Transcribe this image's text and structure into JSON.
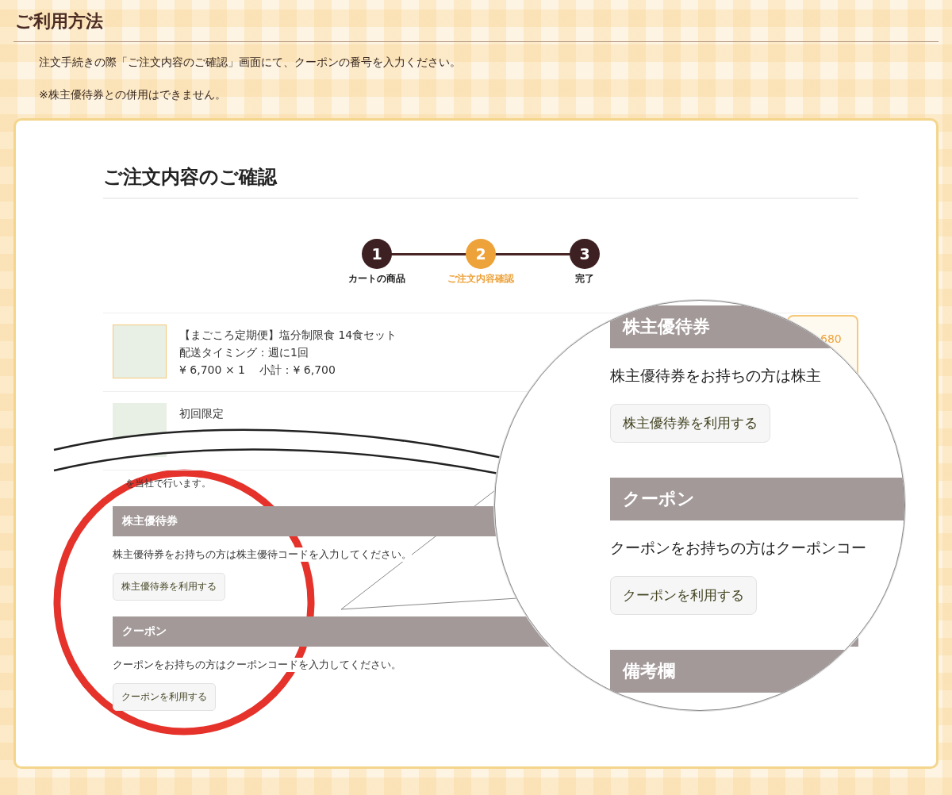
{
  "page_title": "ご利用方法",
  "notes": [
    "注文手続きの際「ご注文内容のご確認」画面にて、クーポンの番号を入力ください。",
    "※株主優待券との併用はできません。"
  ],
  "illustration": {
    "heading": "ご注文内容のご確認",
    "steps": [
      {
        "number": "1",
        "label": "カートの商品",
        "selected": false
      },
      {
        "number": "2",
        "label": "ご注文内容確認",
        "selected": true
      },
      {
        "number": "3",
        "label": "完了",
        "selected": false
      }
    ],
    "cart_items": [
      {
        "lines": [
          "【まごころ定期便】塩分制限食 14食セット",
          "配送タイミング：週に1回",
          "¥ 6,700 × 1　 小計：¥ 6,700"
        ]
      },
      {
        "lines": [
          "初回限定"
        ]
      }
    ],
    "price_badge": "680",
    "cut_text": "を当社で行います。",
    "sections": [
      {
        "title": "株主優待券",
        "text": "株主優待券をお持ちの方は株主優待コードを入力してください。",
        "button": "株主優待券を利用する"
      },
      {
        "title": "クーポン",
        "text": "クーポンをお持ちの方はクーポンコードを入力してください。",
        "button": "クーポンを利用する"
      }
    ],
    "magnified": [
      {
        "title": "株主優待券",
        "text": "株主優待券をお持ちの方は株主",
        "button": "株主優待券を利用する"
      },
      {
        "title": "クーポン",
        "text": "クーポンをお持ちの方はクーポンコー",
        "button": "クーポンを利用する"
      },
      {
        "title": "備考欄"
      }
    ]
  }
}
